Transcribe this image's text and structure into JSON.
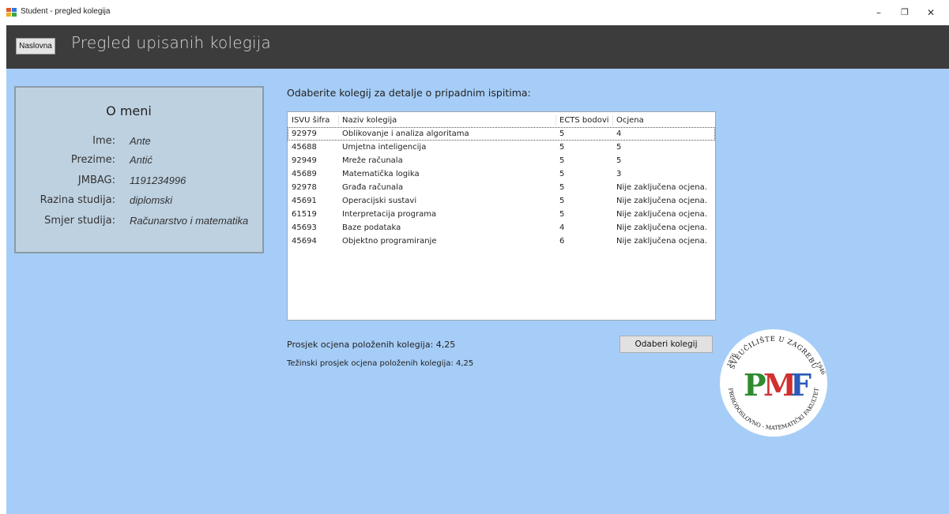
{
  "window": {
    "title": "Student - pregled kolegija",
    "minimize_glyph": "–",
    "maximize_glyph": "❐",
    "close_glyph": "✕"
  },
  "header": {
    "home_button": "Naslovna",
    "title": "Pregled upisanih kolegija"
  },
  "about": {
    "title": "O meni",
    "fields": [
      {
        "label": "Ime:",
        "value": "Ante"
      },
      {
        "label": "Prezime:",
        "value": "Antić"
      },
      {
        "label": "JMBAG:",
        "value": "1191234996"
      },
      {
        "label": "Razina studija:",
        "value": "diplomski"
      },
      {
        "label": "Smjer studija:",
        "value": "Računarstvo i matematika"
      }
    ]
  },
  "prompt": "Odaberite kolegij za detalje o pripadnim ispitima:",
  "table": {
    "columns": [
      "ISVU šifra",
      "Naziv kolegija",
      "ECTS bodovi",
      "Ocjena"
    ],
    "rows": [
      [
        "92979",
        "Oblikovanje i analiza algoritama",
        "5",
        "4"
      ],
      [
        "45688",
        "Umjetna inteligencija",
        "5",
        "5"
      ],
      [
        "92949",
        "Mreže računala",
        "5",
        "5"
      ],
      [
        "45689",
        "Matematička logika",
        "5",
        "3"
      ],
      [
        "92978",
        "Građa računala",
        "5",
        "Nije zaključena ocjena."
      ],
      [
        "45691",
        "Operacijski sustavi",
        "5",
        "Nije zaključena ocjena."
      ],
      [
        "61519",
        "Interpretacija programa",
        "5",
        "Nije zaključena ocjena."
      ],
      [
        "45693",
        "Baze podataka",
        "4",
        "Nije zaključena ocjena."
      ],
      [
        "45694",
        "Objektno programiranje",
        "6",
        "Nije zaključena ocjena."
      ]
    ],
    "selected_row": 0
  },
  "averages": {
    "average": "Prosjek ocjena položenih kolegija: 4,25",
    "weighted_average": "Težinski prosjek ocjena položenih kolegija: 4,25"
  },
  "choose_button": "Odaberi kolegij",
  "logo": {
    "letters": "PMF",
    "ring_text_top": "SVEUČILIŠTE U ZAGREBU",
    "ring_text_bottom": "PRIRODOSLOVNO - MATEMATIČKI FAKULTET",
    "year_left": "1876",
    "year_right": "1946",
    "colors": {
      "P": "#2e8b2e",
      "M": "#d03030",
      "F": "#2c5bb8"
    }
  }
}
